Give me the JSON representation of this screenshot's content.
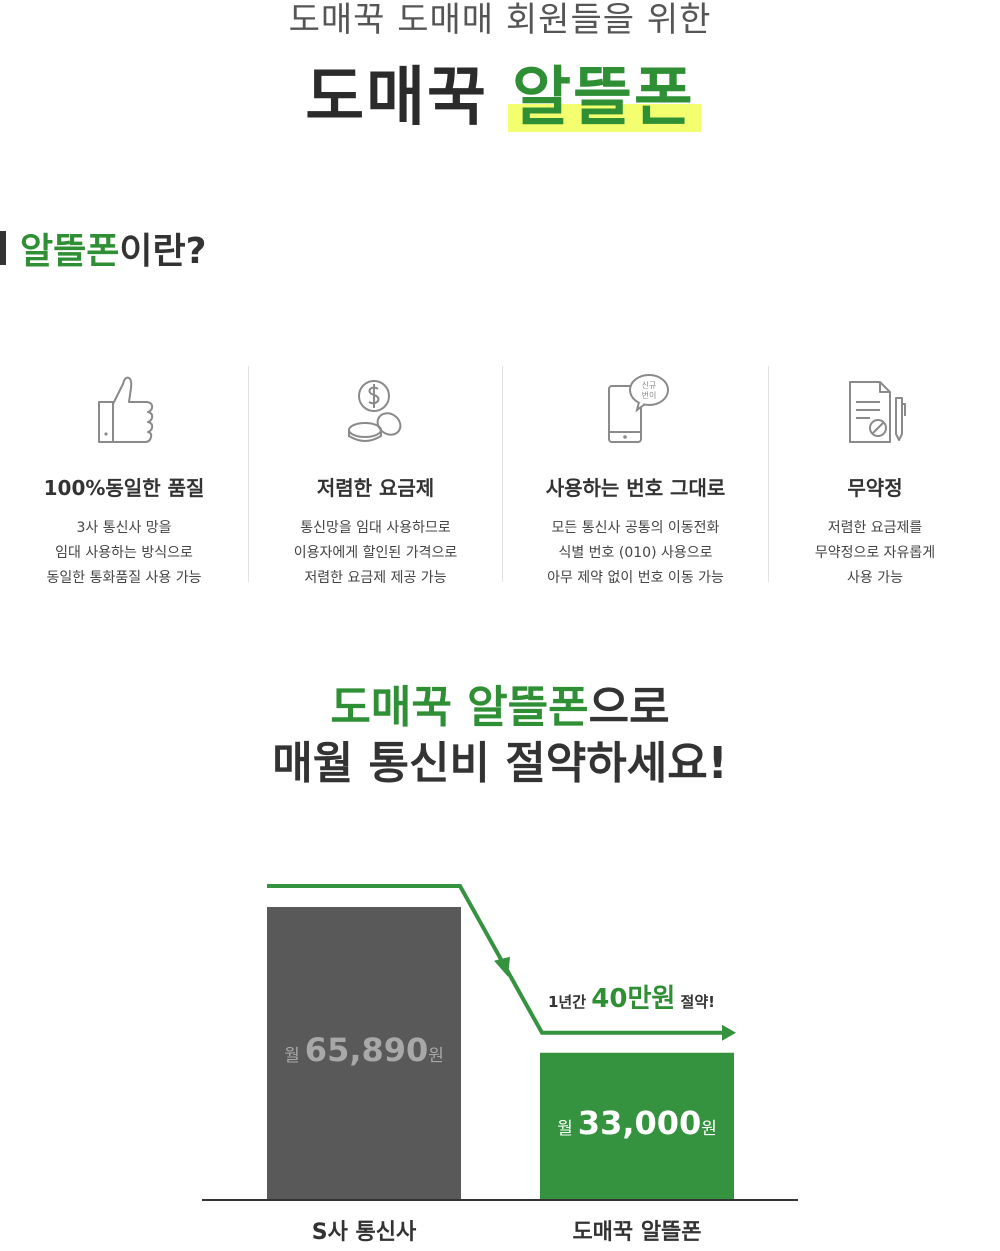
{
  "hero": {
    "subtitle": "도매꾹 도매매 회원들을 위한",
    "title_main": "도매꾹",
    "title_highlight": "알뜰폰"
  },
  "section": {
    "highlight": "알뜰폰",
    "rest": "이란?"
  },
  "features": [
    {
      "icon": "thumbs-up-icon",
      "title": "100%동일한 품질",
      "lines": [
        "3사 통신사 망을",
        "임대 사용하는 방식으로",
        "동일한 통화품질 사용 가능"
      ]
    },
    {
      "icon": "coins-icon",
      "title": "저렴한 요금제",
      "lines": [
        "통신망을 임대 사용하므로",
        "이용자에게 할인된 가격으로",
        "저렴한 요금제 제공 가능"
      ]
    },
    {
      "icon": "phone-number-icon",
      "icon_bubble_lines": [
        "신규",
        "번이"
      ],
      "title": "사용하는 번호 그대로",
      "lines": [
        "모든 통신사 공통의 이동전화",
        "식별 번호 (010) 사용으로",
        "아무 제약 없이 번호 이동 가능"
      ]
    },
    {
      "icon": "contract-cancel-icon",
      "title": "무약정",
      "lines": [
        "저렴한 요금제를",
        "무약정으로 자유롭게",
        "사용 가능"
      ]
    }
  ],
  "savings": {
    "line1_highlight": "도매꾹 알뜰폰",
    "line1_rest": "으로",
    "line2": "매월 통신비 절약하세요!"
  },
  "chart_data": {
    "type": "bar",
    "categories": [
      "S사 통신사",
      "도매꾹 알뜰폰"
    ],
    "values": [
      65890,
      33000
    ],
    "value_labels": [
      {
        "prefix": "월",
        "number": "65,890",
        "suffix": "원"
      },
      {
        "prefix": "월",
        "number": "33,000",
        "suffix": "원"
      }
    ],
    "annotation": {
      "before": "1년간",
      "highlight": "40만원",
      "after": "절약!"
    },
    "colors": {
      "bar_1": "#595959",
      "bar_2": "#35933f",
      "line": "#35933f",
      "value_1": "#a8a8a8",
      "value_2": "#ffffff"
    },
    "ylim": [
      0,
      65890
    ]
  }
}
